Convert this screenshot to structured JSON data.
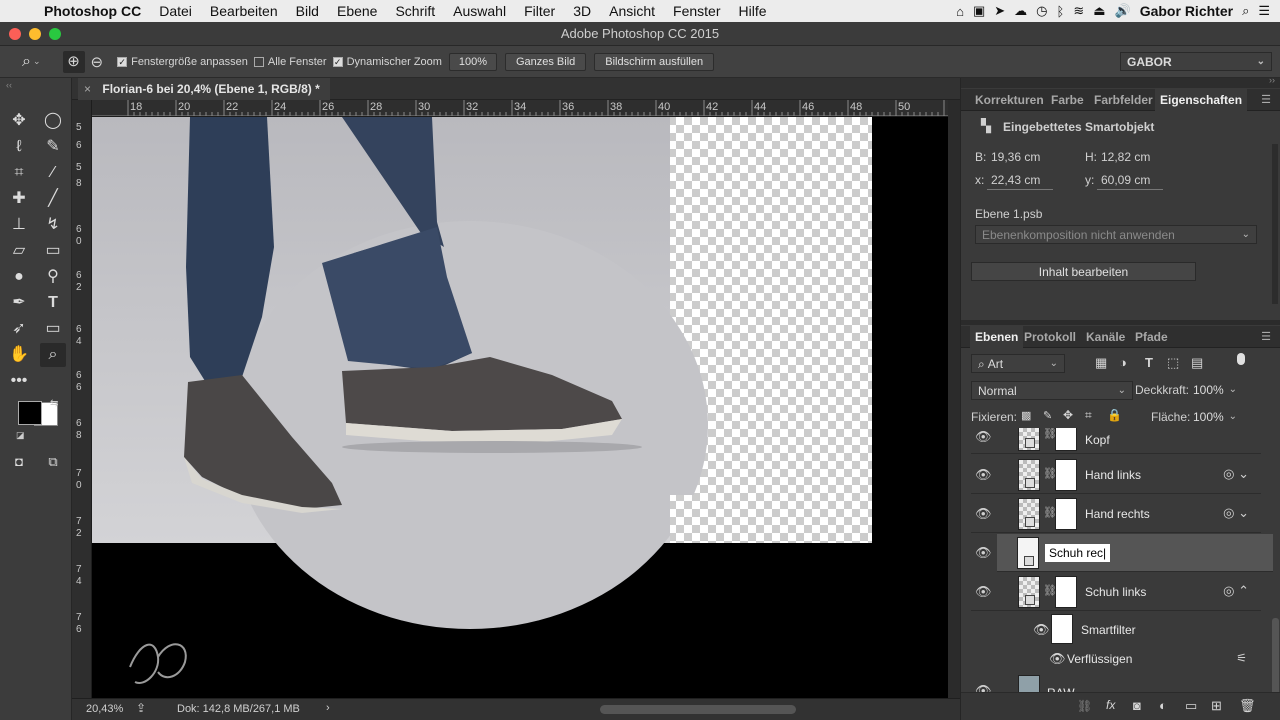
{
  "menubar": {
    "app": "Photoshop CC",
    "items": [
      "Datei",
      "Bearbeiten",
      "Bild",
      "Ebene",
      "Schrift",
      "Auswahl",
      "Filter",
      "3D",
      "Ansicht",
      "Fenster",
      "Hilfe"
    ],
    "user": "Gabor Richter"
  },
  "window": {
    "title": "Adobe Photoshop CC 2015"
  },
  "options": {
    "chk_resize": "Fenstergröße anpassen",
    "chk_all": "Alle Fenster",
    "chk_dynamic": "Dynamischer Zoom",
    "zoom_value": "100%",
    "btn_fit": "Ganzes Bild",
    "btn_fill": "Bildschirm ausfüllen",
    "workspace": "GABOR"
  },
  "document": {
    "tab_title": "Florian-6 bei 20,4% (Ebene 1, RGB/8) *",
    "hruler": [
      "18",
      "20",
      "22",
      "24",
      "26",
      "28",
      "30",
      "32",
      "34",
      "36",
      "38",
      "40",
      "42",
      "44",
      "46",
      "48",
      "50"
    ],
    "vruler": [
      "5",
      "6",
      "5",
      "8",
      "6",
      "0",
      "6",
      "2",
      "6",
      "4",
      "6",
      "6",
      "6",
      "8",
      "7",
      "0",
      "7",
      "2",
      "7",
      "4",
      "7",
      "6"
    ]
  },
  "status": {
    "zoom": "20,43%",
    "doc": "Dok: 142,8 MB/267,1 MB"
  },
  "properties": {
    "tabs": [
      "Korrekturen",
      "Farbe",
      "Farbfelder",
      "Eigenschaften"
    ],
    "active_tab": "Eigenschaften",
    "object_type": "Eingebettetes Smartobjekt",
    "w_label": "B:",
    "w_value": "19,36 cm",
    "h_label": "H:",
    "h_value": "12,82 cm",
    "x_label": "x:",
    "x_value": "22,43 cm",
    "y_label": "y:",
    "y_value": "60,09 cm",
    "source": "Ebene 1.psb",
    "comp": "Ebenenkomposition nicht anwenden",
    "edit_button": "Inhalt bearbeiten"
  },
  "layers_panel": {
    "tabs": [
      "Ebenen",
      "Protokoll",
      "Kanäle",
      "Pfade"
    ],
    "filter": "Art",
    "blend_mode": "Normal",
    "opacity_label": "Deckkraft:",
    "opacity": "100%",
    "lock_label": "Fixieren:",
    "fill_label": "Fläche:",
    "fill": "100%",
    "layers": [
      {
        "name": "Kopf"
      },
      {
        "name": "Hand links"
      },
      {
        "name": "Hand rechts"
      },
      {
        "name": "Schuh rec"
      },
      {
        "name": "Schuh links"
      }
    ],
    "smartfilter": "Smartfilter",
    "filter_item": "Verflüssigen",
    "raw_layer": "RAW"
  }
}
